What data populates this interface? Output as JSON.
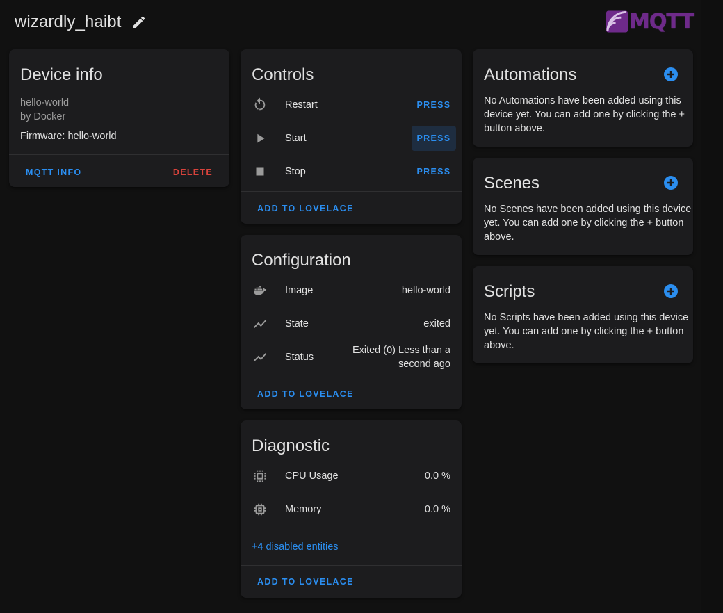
{
  "header": {
    "title": "wizardly_haibt",
    "logo_text": "MQTT",
    "icons": {
      "edit": "pencil-icon",
      "logo": "mqtt-logo"
    }
  },
  "device_info": {
    "title": "Device info",
    "model": "hello-world",
    "manufacturer": "by Docker",
    "firmware": "Firmware: hello-world",
    "mqtt_info_label": "MQTT INFO",
    "delete_label": "DELETE"
  },
  "controls": {
    "title": "Controls",
    "items": [
      {
        "label": "Restart",
        "action": "PRESS",
        "icon": "restart-icon"
      },
      {
        "label": "Start",
        "action": "PRESS",
        "icon": "play-icon"
      },
      {
        "label": "Stop",
        "action": "PRESS",
        "icon": "stop-icon"
      }
    ],
    "add_label": "ADD TO LOVELACE"
  },
  "configuration": {
    "title": "Configuration",
    "items": [
      {
        "label": "Image",
        "value": "hello-world",
        "icon": "docker-icon"
      },
      {
        "label": "State",
        "value": "exited",
        "icon": "chart-line-icon"
      },
      {
        "label": "Status",
        "value_line1": "Exited (0) Less than a",
        "value_line2": "second ago",
        "icon": "chart-line-icon"
      }
    ],
    "add_label": "ADD TO LOVELACE"
  },
  "diagnostic": {
    "title": "Diagnostic",
    "items": [
      {
        "label": "CPU Usage",
        "value": "0.0 %",
        "icon": "cpu-64bit-icon"
      },
      {
        "label": "Memory",
        "value": "0.0 %",
        "icon": "memory-chip-icon"
      }
    ],
    "disabled_link": "+4 disabled entities",
    "add_label": "ADD TO LOVELACE"
  },
  "automations": {
    "title": "Automations",
    "text_lines": [
      "No Automations have been added using this",
      "device yet. You can add one by clicking the +",
      "button above."
    ]
  },
  "scenes": {
    "title": "Scenes",
    "text_lines": [
      "No Scenes have been added using this device",
      "yet. You can add one by clicking the + button",
      "above."
    ]
  },
  "scripts": {
    "title": "Scripts",
    "text_lines": [
      "No Scripts have been added using this device",
      "yet. You can add one by clicking the + button",
      "above."
    ]
  },
  "colors": {
    "background": "#111111",
    "card": "#1c1c1e",
    "accent": "#2b8ef0",
    "danger": "#d9433c",
    "text": "#e1e1e1",
    "muted": "#9b9b9b",
    "logo": "#6e2a8a"
  }
}
